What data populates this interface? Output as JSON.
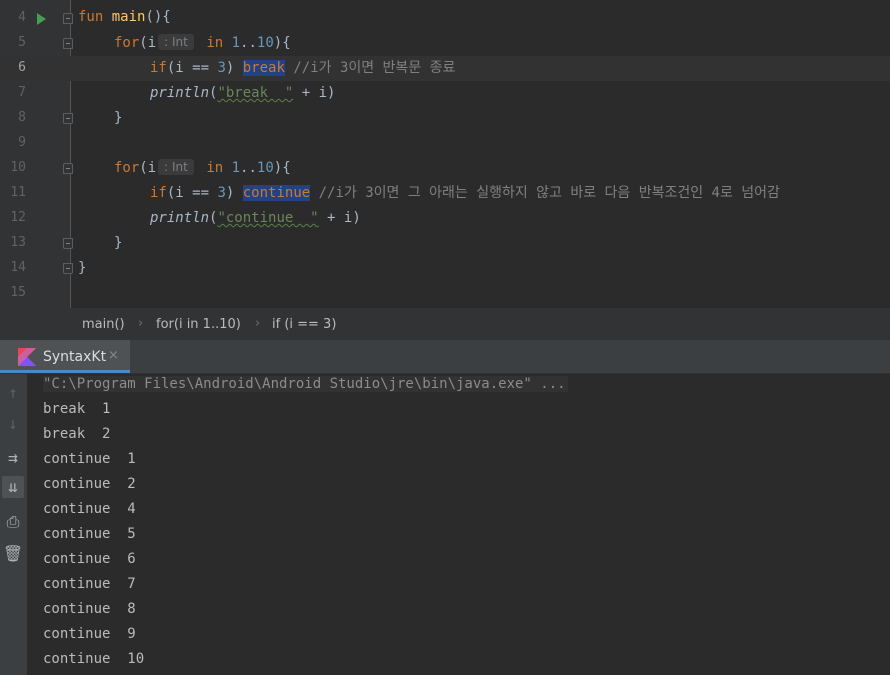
{
  "editor": {
    "lines": [
      {
        "num": "4"
      },
      {
        "num": "5"
      },
      {
        "num": "6"
      },
      {
        "num": "7"
      },
      {
        "num": "8"
      },
      {
        "num": "9"
      },
      {
        "num": "10"
      },
      {
        "num": "11"
      },
      {
        "num": "12"
      },
      {
        "num": "13"
      },
      {
        "num": "14"
      },
      {
        "num": "15"
      }
    ],
    "code": {
      "l4_kw": "fun",
      "l4_fn": "main",
      "l4_rest": "(){",
      "for_kw": "for",
      "paren_i": "(i",
      "hint_int": ": Int",
      "in_kw": "in",
      "range_1": "1",
      "range_dots": "..",
      "range_10": "10",
      "brace_open": "){",
      "if_kw": "if",
      "cond_a": "(i == ",
      "three": "3",
      "cond_b": ")",
      "break_kw": "break",
      "comment_break": "//i가 3이면 반복문 종료",
      "println": "println",
      "paren_open": "(",
      "str_break": "\"break  \"",
      "plus_i": " + i)",
      "brace_close": "}",
      "continue_kw": "continue",
      "comment_continue": "//i가 3이면 그 아래는 실행하지 않고 바로 다음 반복조건인 4로 넘어감",
      "str_continue": "\"continue  \""
    }
  },
  "breadcrumb": {
    "items": [
      "main()",
      "for(i in 1..10)",
      "if (i == 3)"
    ],
    "separator": "›"
  },
  "run_window": {
    "tab_label": "SyntaxKt",
    "tab_close": "×",
    "toolbar": {
      "up": "↑",
      "down": "↓",
      "wrap": "⇉",
      "scroll_end": "⇊",
      "print": "⎙",
      "trash": "🗑"
    },
    "output": [
      "\"C:\\Program Files\\Android\\Android Studio\\jre\\bin\\java.exe\" ...",
      "break  1",
      "break  2",
      "continue  1",
      "continue  2",
      "continue  4",
      "continue  5",
      "continue  6",
      "continue  7",
      "continue  8",
      "continue  9",
      "continue  10"
    ]
  },
  "colors": {
    "editor_bg": "#2b2b2b",
    "keyword": "#cc7832",
    "function": "#ffc66d",
    "number": "#6897bb",
    "string": "#6a8759",
    "comment": "#808080",
    "selection": "#214283",
    "run_icon": "#499c54",
    "tab_underline": "#4a88c7"
  },
  "icons": {
    "run_gutter": "run-triangle-icon",
    "kotlin": "kotlin-logo-icon"
  }
}
